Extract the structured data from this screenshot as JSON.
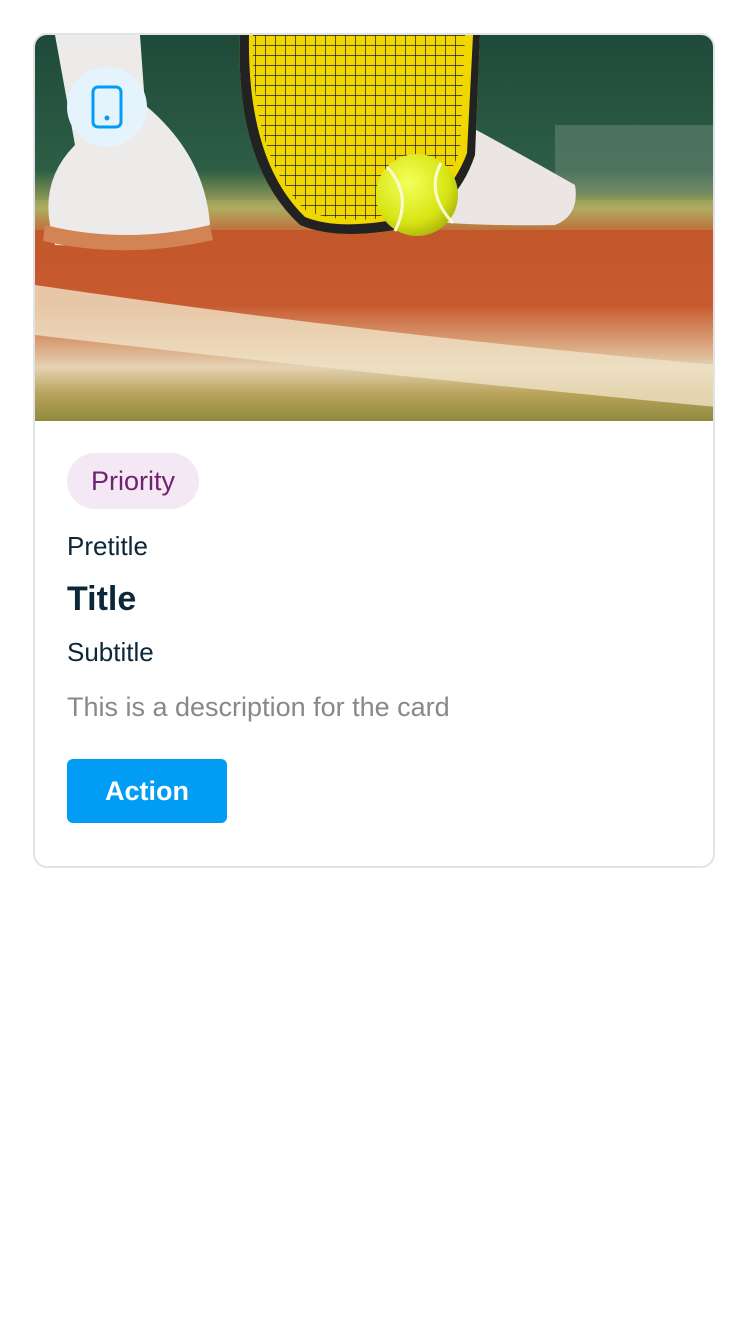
{
  "card": {
    "media_icon": "mobile-device-icon",
    "tag": "Priority",
    "pretitle": "Pretitle",
    "title": "Title",
    "subtitle": "Subtitle",
    "description": "This is a description for the card",
    "action_label": "Action"
  },
  "colors": {
    "brand": "#019df4",
    "tag_background": "#f4e8f4",
    "tag_text": "#70216f",
    "text_primary": "#0b2739",
    "text_secondary": "#86888c",
    "icon_background": "#e5f3fd"
  }
}
